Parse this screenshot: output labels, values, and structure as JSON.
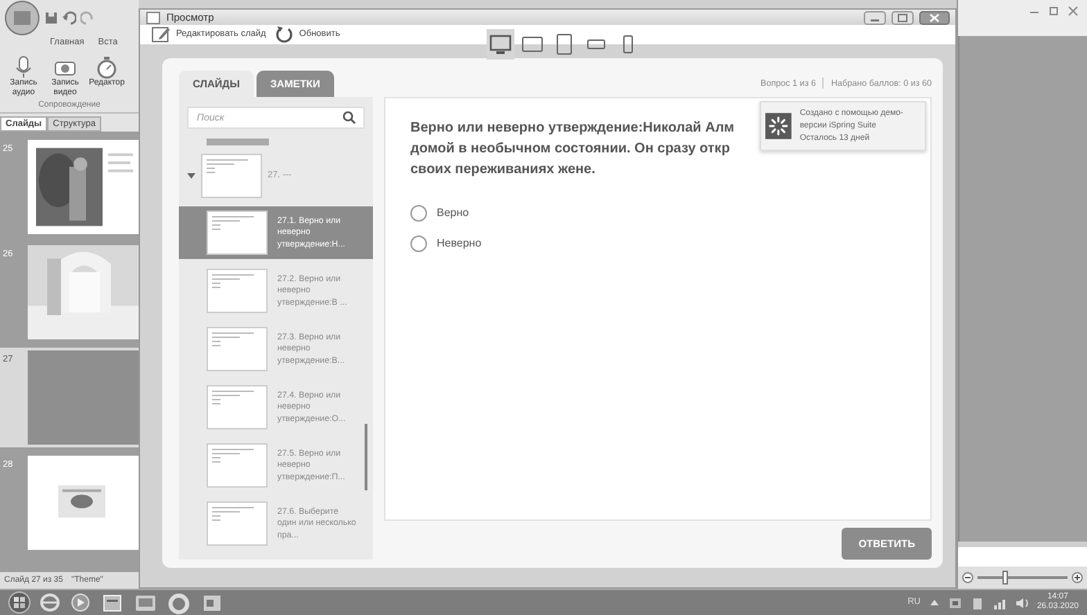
{
  "powerpoint": {
    "ribbon_tabs": [
      "Главная",
      "Вста"
    ],
    "ribbon_buttons": [
      {
        "label": "Запись аудио",
        "kind": "microphone"
      },
      {
        "label": "Запись видео",
        "kind": "camera"
      },
      {
        "label": "Редактор",
        "kind": "stopwatch"
      }
    ],
    "ribbon_group": "Сопровождение",
    "pane_tabs": [
      {
        "label": "Слайды",
        "selected": true
      },
      {
        "label": "Структура",
        "selected": false
      }
    ],
    "slides": [
      {
        "number": "25",
        "kind": "painting",
        "selected": false
      },
      {
        "number": "26",
        "kind": "arch",
        "selected": false
      },
      {
        "number": "27",
        "kind": "blank",
        "selected": true
      },
      {
        "number": "28",
        "kind": "diagram",
        "selected": false
      }
    ],
    "status_bar": [
      "Слайд 27 из 35",
      "\"Theme\""
    ],
    "zoom_slider": {
      "level": 0.3
    }
  },
  "preview": {
    "window": {
      "title": "Просмотр"
    },
    "toolbar": [
      {
        "label": "Редактировать слайд",
        "kind": "edit"
      },
      {
        "label": "Обновить",
        "kind": "refresh"
      }
    ],
    "devices": [
      {
        "kind": "desktop",
        "selected": true
      },
      {
        "kind": "tablet-landscape",
        "selected": false
      },
      {
        "kind": "tablet-portrait",
        "selected": false
      },
      {
        "kind": "phone-landscape",
        "selected": false
      },
      {
        "kind": "phone-portrait",
        "selected": false
      }
    ],
    "tabs": [
      {
        "label": "СЛАЙДЫ",
        "selected": true
      },
      {
        "label": "ЗАМЕТКИ",
        "selected": false
      }
    ],
    "search": {
      "placeholder": "Поиск"
    },
    "outline": [
      {
        "label": "27. ---",
        "expanded": true,
        "selected": false,
        "children": [
          {
            "label": "27.1. Верно или неверно утверждение:Н...",
            "selected": true
          },
          {
            "label": "27.2. Верно или неверно утверждение:В ...",
            "selected": false
          },
          {
            "label": "27.3. Верно или неверно утверждение:В...",
            "selected": false
          },
          {
            "label": "27.4. Верно или неверно утверждение:О...",
            "selected": false
          },
          {
            "label": "27.5. Верно или неверно утверждение:П...",
            "selected": false
          },
          {
            "label": "27.6. Выберите один или несколько пра...",
            "selected": false
          }
        ]
      }
    ],
    "progress": [
      "Вопрос 1 из 6",
      "Набрано баллов: 0 из 60"
    ],
    "question_lines": [
      "Верно или неверно утверждение:Николай Алм",
      "домой в необычном состоянии. Он сразу откр",
      "своих переживаниях жене."
    ],
    "options": [
      {
        "label": "Верно",
        "selected": false
      },
      {
        "label": "Неверно",
        "selected": false
      }
    ],
    "submit": "ОТВЕТИТЬ",
    "notice": [
      "Создано с помощью демо-версии iSpring Suite",
      "Осталось 13 дней"
    ]
  },
  "taskbar": {
    "language": "RU",
    "time": "14:07",
    "date": "26.03.2020"
  }
}
